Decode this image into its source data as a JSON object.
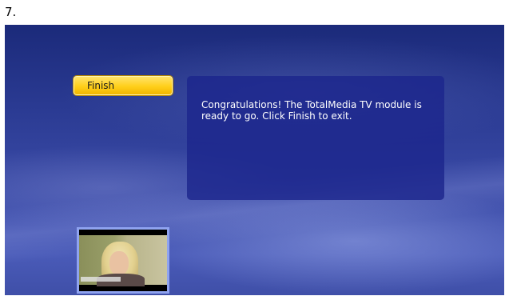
{
  "step": {
    "label": "7."
  },
  "wizard": {
    "finish_button_label": "Finish",
    "message": "Congratulations! The TotalMedia TV module is ready to go. Click Finish to exit."
  },
  "colors": {
    "background_top": "#1b2a7a",
    "background_bottom": "#4a5bb8",
    "button_accent": "#ffcf1a",
    "panel": "#1c268c",
    "thumbnail_border": "#8fa3f0"
  },
  "icons": {
    "video_preview": "live-tv-preview-thumbnail"
  }
}
